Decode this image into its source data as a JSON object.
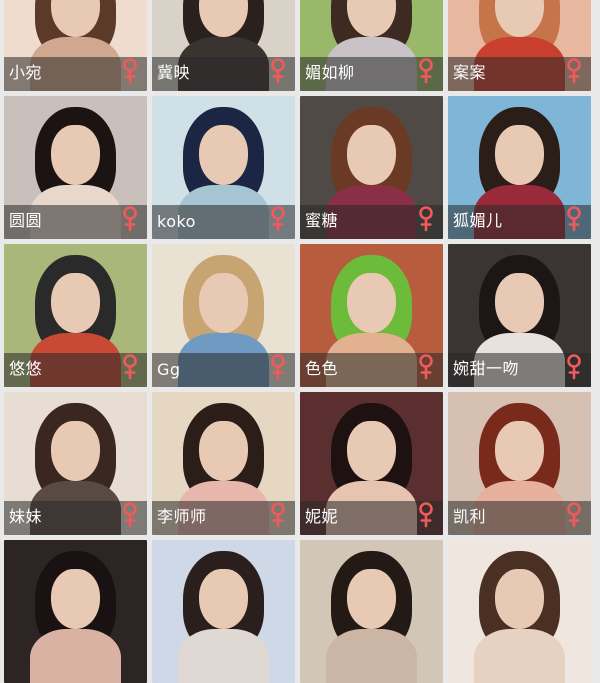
{
  "tiles": [
    {
      "name": "小宛",
      "bg": "#f0dccf",
      "hair": "#5b3a2a",
      "body": "#d0a890"
    },
    {
      "name": "冀映",
      "bg": "#d8d2c8",
      "hair": "#2a211c",
      "body": "#3a3431"
    },
    {
      "name": "媚如柳",
      "bg": "#9ab86a",
      "hair": "#3d2a22",
      "body": "#c9c3c7"
    },
    {
      "name": "案案",
      "bg": "#e7b7a0",
      "hair": "#c6744a",
      "body": "#c9402f"
    },
    {
      "name": "圆圆",
      "bg": "#c9c0bb",
      "hair": "#1c1412",
      "body": "#e8d8cc"
    },
    {
      "name": "koko",
      "bg": "#cfe0e6",
      "hair": "#1b2645",
      "body": "#a6c5d3"
    },
    {
      "name": "蜜糖",
      "bg": "#4f4a46",
      "hair": "#6b3a24",
      "body": "#8a2f45"
    },
    {
      "name": "狐媚儿",
      "bg": "#7fb6d8",
      "hair": "#2b1e18",
      "body": "#9a2a3a"
    },
    {
      "name": "悠悠",
      "bg": "#a9b87a",
      "hair": "#2a2a2a",
      "body": "#c84a35"
    },
    {
      "name": "Gg",
      "bg": "#e9e1d2",
      "hair": "#c8a472",
      "body": "#6f9bc2"
    },
    {
      "name": "色色",
      "bg": "#b85c3e",
      "hair": "#6dbb3a",
      "body": "#e2b18f"
    },
    {
      "name": "婉甜一吻",
      "bg": "#3a3433",
      "hair": "#1c1716",
      "body": "#e7e2dc"
    },
    {
      "name": "妹妹",
      "bg": "#e7ddd2",
      "hair": "#3a2720",
      "body": "#5a4a44"
    },
    {
      "name": "李师师",
      "bg": "#e6d7c2",
      "hair": "#2b1d18",
      "body": "#e8b7ab"
    },
    {
      "name": "妮妮",
      "bg": "#5b2f2f",
      "hair": "#1d1211",
      "body": "#e7c4b2"
    },
    {
      "name": "凯利",
      "bg": "#d6c0b2",
      "hair": "#7a2a1b",
      "body": "#e7b09c"
    },
    {
      "name": "",
      "bg": "#2d2424",
      "hair": "#1a1212",
      "body": "#d9b2a4"
    },
    {
      "name": "",
      "bg": "#cfd8e6",
      "hair": "#2a1f1c",
      "body": "#e0d8d2"
    },
    {
      "name": "",
      "bg": "#d2c7b7",
      "hair": "#231a16",
      "body": "#cbb6a5"
    },
    {
      "name": "",
      "bg": "#efe7df",
      "hair": "#4a2f23",
      "body": "#e7d1c1"
    }
  ],
  "colors": {
    "female_icon": "#f15a5a"
  }
}
